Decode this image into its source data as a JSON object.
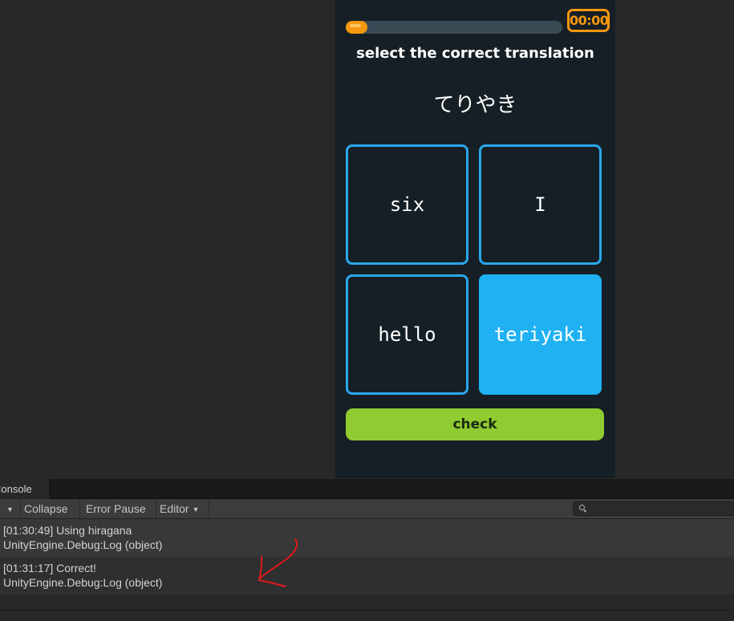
{
  "game": {
    "progress": 0.1,
    "timer": "00:00",
    "prompt": "select the correct translation",
    "word": "てりやき",
    "options": [
      {
        "label": "six",
        "selected": false
      },
      {
        "label": "I",
        "selected": false
      },
      {
        "label": "hello",
        "selected": false
      },
      {
        "label": "teriyaki",
        "selected": true
      }
    ],
    "check_label": "check"
  },
  "console": {
    "tab": "Console",
    "toolbar": {
      "collapse": "Collapse",
      "error_pause": "Error Pause",
      "editor": "Editor"
    },
    "search": {
      "placeholder": ""
    },
    "logs": [
      {
        "message": "[01:30:49] Using hiragana",
        "trace": "UnityEngine.Debug:Log (object)"
      },
      {
        "message": "[01:31:17] Correct!",
        "trace": "UnityEngine.Debug:Log (object)"
      }
    ]
  },
  "colors": {
    "accent_blue": "#1fb1f2",
    "check_green": "#8fcb31",
    "timer_orange": "#f5980f",
    "annotation_red": "#e0181c"
  },
  "icons": {
    "dropdown": "chevron-down-icon",
    "search": "search-icon",
    "annotation": "arrow-icon"
  }
}
